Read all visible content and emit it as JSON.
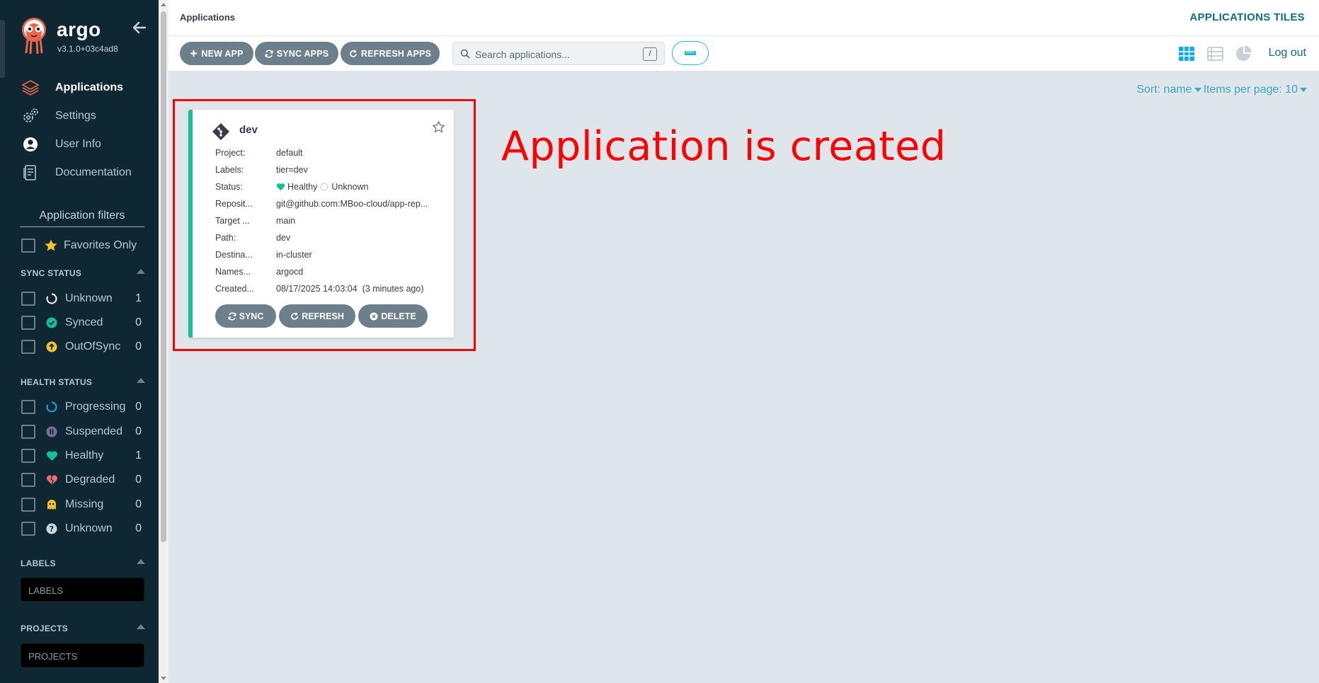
{
  "app": {
    "name": "argo",
    "version": "v3.1.0+03c4ad8"
  },
  "nav": {
    "items": [
      {
        "label": "Applications",
        "icon": "layers-icon",
        "active": true
      },
      {
        "label": "Settings",
        "icon": "gears-icon",
        "active": false
      },
      {
        "label": "User Info",
        "icon": "user-circle-icon",
        "active": false
      },
      {
        "label": "Documentation",
        "icon": "book-icon",
        "active": false
      }
    ]
  },
  "filters": {
    "title": "Application filters",
    "favorites_label": "Favorites Only",
    "sync_status": {
      "heading": "SYNC STATUS",
      "items": [
        {
          "label": "Unknown",
          "count": "1",
          "icon": "circle-notch-icon",
          "color": "#ffffff"
        },
        {
          "label": "Synced",
          "count": "0",
          "icon": "check-circle-icon",
          "color": "#18be94"
        },
        {
          "label": "OutOfSync",
          "count": "0",
          "icon": "arrow-circle-up-icon",
          "color": "#f4c030"
        }
      ]
    },
    "health_status": {
      "heading": "HEALTH STATUS",
      "items": [
        {
          "label": "Progressing",
          "count": "0",
          "icon": "circle-notch-icon",
          "color": "#0dadea"
        },
        {
          "label": "Suspended",
          "count": "0",
          "icon": "pause-circle-icon",
          "color": "#766f94"
        },
        {
          "label": "Healthy",
          "count": "1",
          "icon": "heart-icon",
          "color": "#18be94"
        },
        {
          "label": "Degraded",
          "count": "0",
          "icon": "heart-broken-icon",
          "color": "#e96d76"
        },
        {
          "label": "Missing",
          "count": "0",
          "icon": "ghost-icon",
          "color": "#f4c030"
        },
        {
          "label": "Unknown",
          "count": "0",
          "icon": "question-circle-icon",
          "color": "#ccd6dd"
        }
      ]
    },
    "labels": {
      "heading": "LABELS",
      "placeholder": "LABELS"
    },
    "projects": {
      "heading": "PROJECTS",
      "placeholder": "PROJECTS"
    }
  },
  "topbar": {
    "breadcrumb": "Applications",
    "title": "APPLICATIONS TILES",
    "logout": "Log out"
  },
  "toolbar": {
    "new_app": "NEW APP",
    "sync_apps": "SYNC APPS",
    "refresh_apps": "REFRESH APPS",
    "search_placeholder": "Search applications...",
    "search_shortcut": "/"
  },
  "sort": {
    "sort_label": "Sort: name",
    "per_page_label": "Items per page: 10"
  },
  "card": {
    "name": "dev",
    "rows": [
      {
        "key": "Project:",
        "value": "default"
      },
      {
        "key": "Labels:",
        "value": "tier=dev"
      },
      {
        "key": "Status:",
        "value": ""
      },
      {
        "key": "Reposit...",
        "value": "git@github.com:MBoo-cloud/app-rep..."
      },
      {
        "key": "Target ...",
        "value": "main"
      },
      {
        "key": "Path:",
        "value": "dev"
      },
      {
        "key": "Destina...",
        "value": "in-cluster"
      },
      {
        "key": "Names...",
        "value": "argocd"
      },
      {
        "key": "Created...",
        "value": "08/17/2025 14:03:04  (3 minutes ago)"
      }
    ],
    "health": "Healthy",
    "sync": "Unknown",
    "actions": {
      "sync": "SYNC",
      "refresh": "REFRESH",
      "delete": "DELETE"
    }
  },
  "annotation": "Application is created",
  "colors": {
    "sidebar_bg": "#0f2733",
    "accent": "#0d6d85",
    "button_bg": "#6d7f8b",
    "healthy": "#18be94",
    "annotation": "#ff0000"
  }
}
